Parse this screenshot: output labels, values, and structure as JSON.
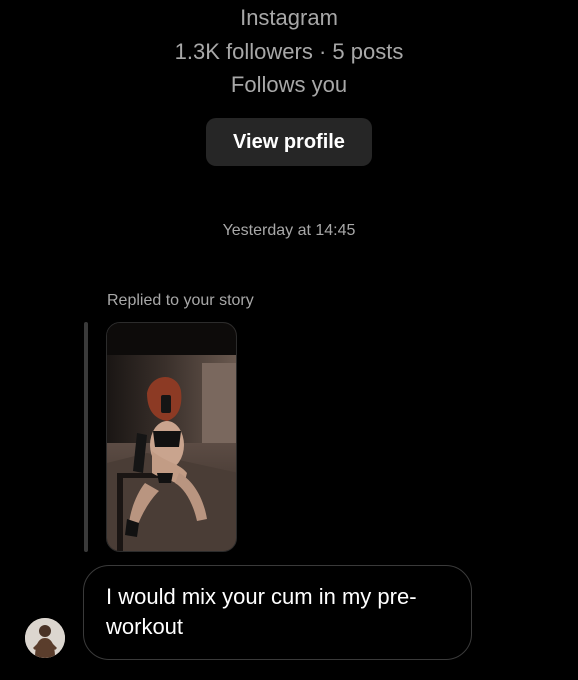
{
  "profile": {
    "source": "Instagram",
    "stats": "1.3K followers · 5 posts",
    "follows": "Follows you",
    "view_profile_label": "View profile"
  },
  "conversation": {
    "timestamp": "Yesterday at 14:45",
    "reply_context": "Replied to your story",
    "message_text": "I would mix your cum in my pre-workout"
  },
  "colors": {
    "background": "#000000",
    "secondary_text": "#a8a8a8",
    "button_bg": "#262626",
    "bubble_border": "#3a3a3a"
  },
  "icons": {
    "story": "story-thumbnail-image",
    "avatar": "sender-avatar-image"
  }
}
